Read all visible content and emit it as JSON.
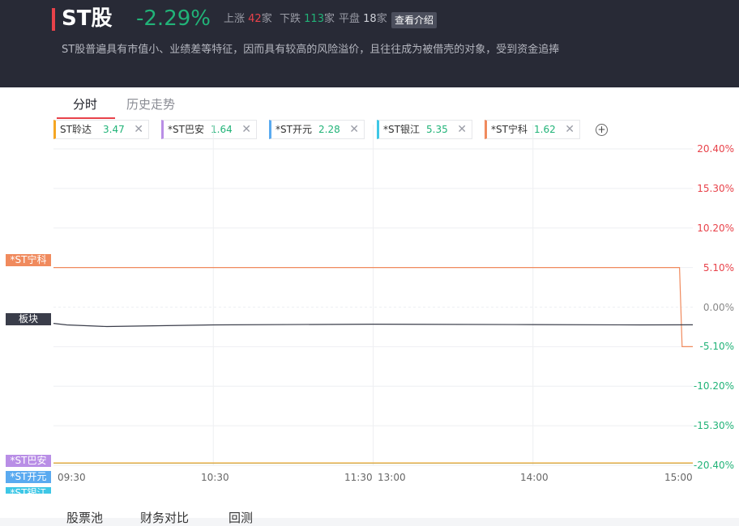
{
  "header": {
    "title": "ST股",
    "change": "-2.29%",
    "up_label": "上涨",
    "up_count": "42",
    "down_label": "下跌",
    "down_count": "113",
    "flat_label": "平盘",
    "flat_count": "18",
    "unit": "家",
    "intro_button": "查看介绍",
    "description": "ST股普遍具有市值小、业绩差等特征，因而具有较高的风险溢价，且往往成为被借壳的对象，受到资金追捧"
  },
  "tabs": [
    {
      "label": "分时",
      "active": true
    },
    {
      "label": "历史走势",
      "active": false
    }
  ],
  "compare_chips": [
    {
      "name": "ST聆达",
      "price": "3.47",
      "color": "#f5a623"
    },
    {
      "name": "*ST巴安",
      "price": "1.64",
      "color": "#b98ee6"
    },
    {
      "name": "*ST开元",
      "price": "2.28",
      "color": "#5aaaf0"
    },
    {
      "name": "*ST银江",
      "price": "5.35",
      "color": "#3ec7e6"
    },
    {
      "name": "*ST宁科",
      "price": "1.62",
      "color": "#f08a5d"
    }
  ],
  "add_button": "+",
  "close_symbol": "✕",
  "chart_data": {
    "type": "line",
    "y_ticks": [
      "20.40%",
      "15.30%",
      "10.20%",
      "5.10%",
      "0.00%",
      "-5.10%",
      "-10.20%",
      "-15.30%",
      "-20.40%"
    ],
    "y_tick_values": [
      20.4,
      15.3,
      10.2,
      5.1,
      0,
      -5.1,
      -10.2,
      -15.3,
      -20.4
    ],
    "ylim": [
      -20.4,
      20.4
    ],
    "x_ticks": [
      "09:30",
      "10:30",
      "11:30",
      "13:00",
      "14:00",
      "15:00"
    ],
    "grid": true,
    "series": [
      {
        "name": "*ST宁科",
        "color": "#f08a5d",
        "tag_color": "#f08a5d",
        "values": [
          [
            0,
            5.1
          ],
          [
            235,
            5.1
          ],
          [
            236,
            -5.1
          ],
          [
            240,
            -5.1
          ]
        ]
      },
      {
        "name": "板块",
        "color": "#3a3d4a",
        "tag_color": "#3a3d4a",
        "values": [
          [
            0,
            -2.1
          ],
          [
            5,
            -2.3
          ],
          [
            20,
            -2.5
          ],
          [
            60,
            -2.3
          ],
          [
            120,
            -2.2
          ],
          [
            180,
            -2.25
          ],
          [
            220,
            -2.3
          ],
          [
            240,
            -2.29
          ]
        ]
      },
      {
        "name": "*ST巴安",
        "color": "#b98ee6",
        "tag_color": "#b98ee6",
        "values": [
          [
            0,
            -20.1
          ],
          [
            240,
            -20.1
          ]
        ]
      },
      {
        "name": "*ST开元",
        "color": "#5aaaf0",
        "tag_color": "#5aaaf0",
        "values": [
          [
            0,
            -20.1
          ],
          [
            240,
            -20.1
          ]
        ]
      },
      {
        "name": "*ST银江",
        "color": "#3ec7e6",
        "tag_color": "#3ec7e6",
        "values": [
          [
            0,
            -20.1
          ],
          [
            240,
            -20.1
          ]
        ]
      },
      {
        "name": "ST聆达",
        "color": "#f5a623",
        "tag_color": "#f5a623",
        "values": [
          [
            0,
            -20.1
          ],
          [
            240,
            -20.1
          ]
        ]
      }
    ]
  },
  "bottom_tabs": [
    "股票池",
    "财务对比",
    "回测"
  ],
  "colors": {
    "up": "#e8424a",
    "down": "#21b378",
    "accent": "#e8424a"
  }
}
